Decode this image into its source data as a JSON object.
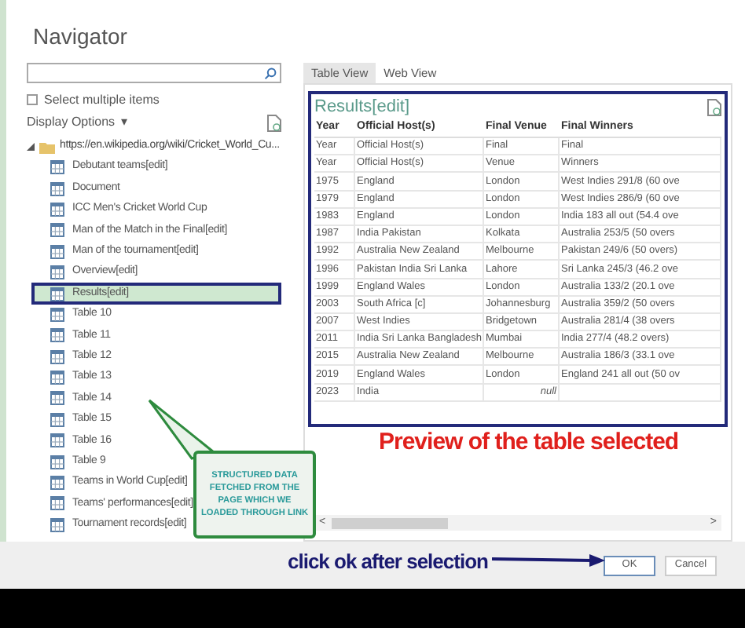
{
  "window": {
    "title": "Navigator"
  },
  "select_multiple": {
    "label": "Select multiple items",
    "checked": false
  },
  "display_options": {
    "label": "Display Options",
    "caret": "▾"
  },
  "tree": {
    "label": "https://en.wikipedia.org/wiki/Cricket_World_Cu...",
    "expanded": true,
    "children": [
      {
        "label": "Debutant teams[edit]",
        "selected": false
      },
      {
        "label": "Document",
        "selected": false
      },
      {
        "label": "ICC Men's Cricket World Cup",
        "selected": false
      },
      {
        "label": "Man of the Match in the Final[edit]",
        "selected": false
      },
      {
        "label": "Man of the tournament[edit]",
        "selected": false
      },
      {
        "label": "Overview[edit]",
        "selected": false
      },
      {
        "label": "Results[edit]",
        "selected": true
      },
      {
        "label": "Table 10",
        "selected": false
      },
      {
        "label": "Table 11",
        "selected": false
      },
      {
        "label": "Table 12",
        "selected": false
      },
      {
        "label": "Table 13",
        "selected": false
      },
      {
        "label": "Table 14",
        "selected": false
      },
      {
        "label": "Table 15",
        "selected": false
      },
      {
        "label": "Table 16",
        "selected": false
      },
      {
        "label": "Table 9",
        "selected": false
      },
      {
        "label": "Teams in World Cup[edit]",
        "selected": false
      },
      {
        "label": "Teams' performances[edit]",
        "selected": false
      },
      {
        "label": "Tournament records[edit]",
        "selected": false
      }
    ]
  },
  "view_tabs": [
    {
      "label": "Table View",
      "selected": true
    },
    {
      "label": "Web View",
      "selected": false
    }
  ],
  "preview": {
    "title": "Results[edit]",
    "table": {
      "columns": [
        "Year",
        "Official Host(s)",
        "Final Venue",
        "Final Winners"
      ],
      "rows": [
        [
          "Year",
          "Official Host(s)",
          "Final",
          "Final"
        ],
        [
          "Year",
          "Official Host(s)",
          "Venue",
          "Winners"
        ],
        [
          "1975",
          "England",
          "London",
          "West Indies 291/8 (60 ove"
        ],
        [
          "1979",
          "England",
          "London",
          "West Indies 286/9 (60 ove"
        ],
        [
          "1983",
          "England",
          "London",
          "India 183 all out (54.4 ove"
        ],
        [
          "1987",
          "India Pakistan",
          "Kolkata",
          "Australia 253/5 (50 overs"
        ],
        [
          "1992",
          "Australia New Zealand",
          "Melbourne",
          "Pakistan 249/6 (50 overs)"
        ],
        [
          "1996",
          "Pakistan India Sri Lanka",
          "Lahore",
          "Sri Lanka 245/3 (46.2 ove"
        ],
        [
          "1999",
          "England Wales",
          "London",
          "Australia 133/2 (20.1 ove"
        ],
        [
          "2003",
          "South Africa [c]",
          "Johannesburg",
          "Australia 359/2 (50 overs"
        ],
        [
          "2007",
          "West Indies",
          "Bridgetown",
          "Australia 281/4 (38 overs"
        ],
        [
          "2011",
          "India Sri Lanka Bangladesh",
          "Mumbai",
          "India 277/4 (48.2 overs)"
        ],
        [
          "2015",
          "Australia New Zealand",
          "Melbourne",
          "Australia 186/3 (33.1 ove"
        ],
        [
          "2019",
          "England Wales",
          "London",
          "England 241 all out (50 ov"
        ],
        [
          "2023",
          "India",
          "null",
          ""
        ]
      ]
    },
    "scroll_left": "<",
    "scroll_right": ">"
  },
  "annotations": {
    "preview_note": "Preview of the table selected",
    "callout": "STRUCTURED DATA FETCHED FROM THE PAGE WHICH WE LOADED THROUGH LINK",
    "click_note": "click ok after selection"
  },
  "buttons": [
    {
      "label": "OK",
      "kind": "primary"
    },
    {
      "label": "Cancel",
      "kind": "secondary"
    }
  ]
}
